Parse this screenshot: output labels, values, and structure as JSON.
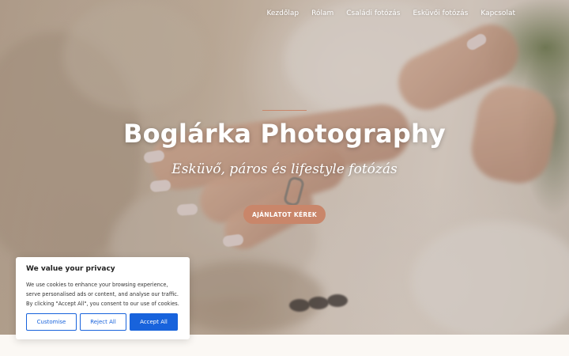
{
  "nav": {
    "items": [
      {
        "label": "Kezdőlap"
      },
      {
        "label": "Rólam"
      },
      {
        "label": "Családi fotózás"
      },
      {
        "label": "Esküvői fotózás"
      },
      {
        "label": "Kapcsolat"
      }
    ]
  },
  "hero": {
    "title": "Boglárka Photography",
    "subtitle": "Esküvő, páros és lifestyle fotózás",
    "cta_label": "AJÁNLATOT KÉREK"
  },
  "cookie_banner": {
    "title": "We value your privacy",
    "text": "We use cookies to enhance your browsing experience, serve personalised ads or content, and analyse our traffic. By clicking \"Accept All\", you consent to our use of cookies.",
    "customise_label": "Customise",
    "reject_label": "Reject All",
    "accept_label": "Accept All"
  },
  "colors": {
    "accent": "#c9866a",
    "cookie_primary": "#1863dc",
    "nav_text": "#ffffff"
  }
}
